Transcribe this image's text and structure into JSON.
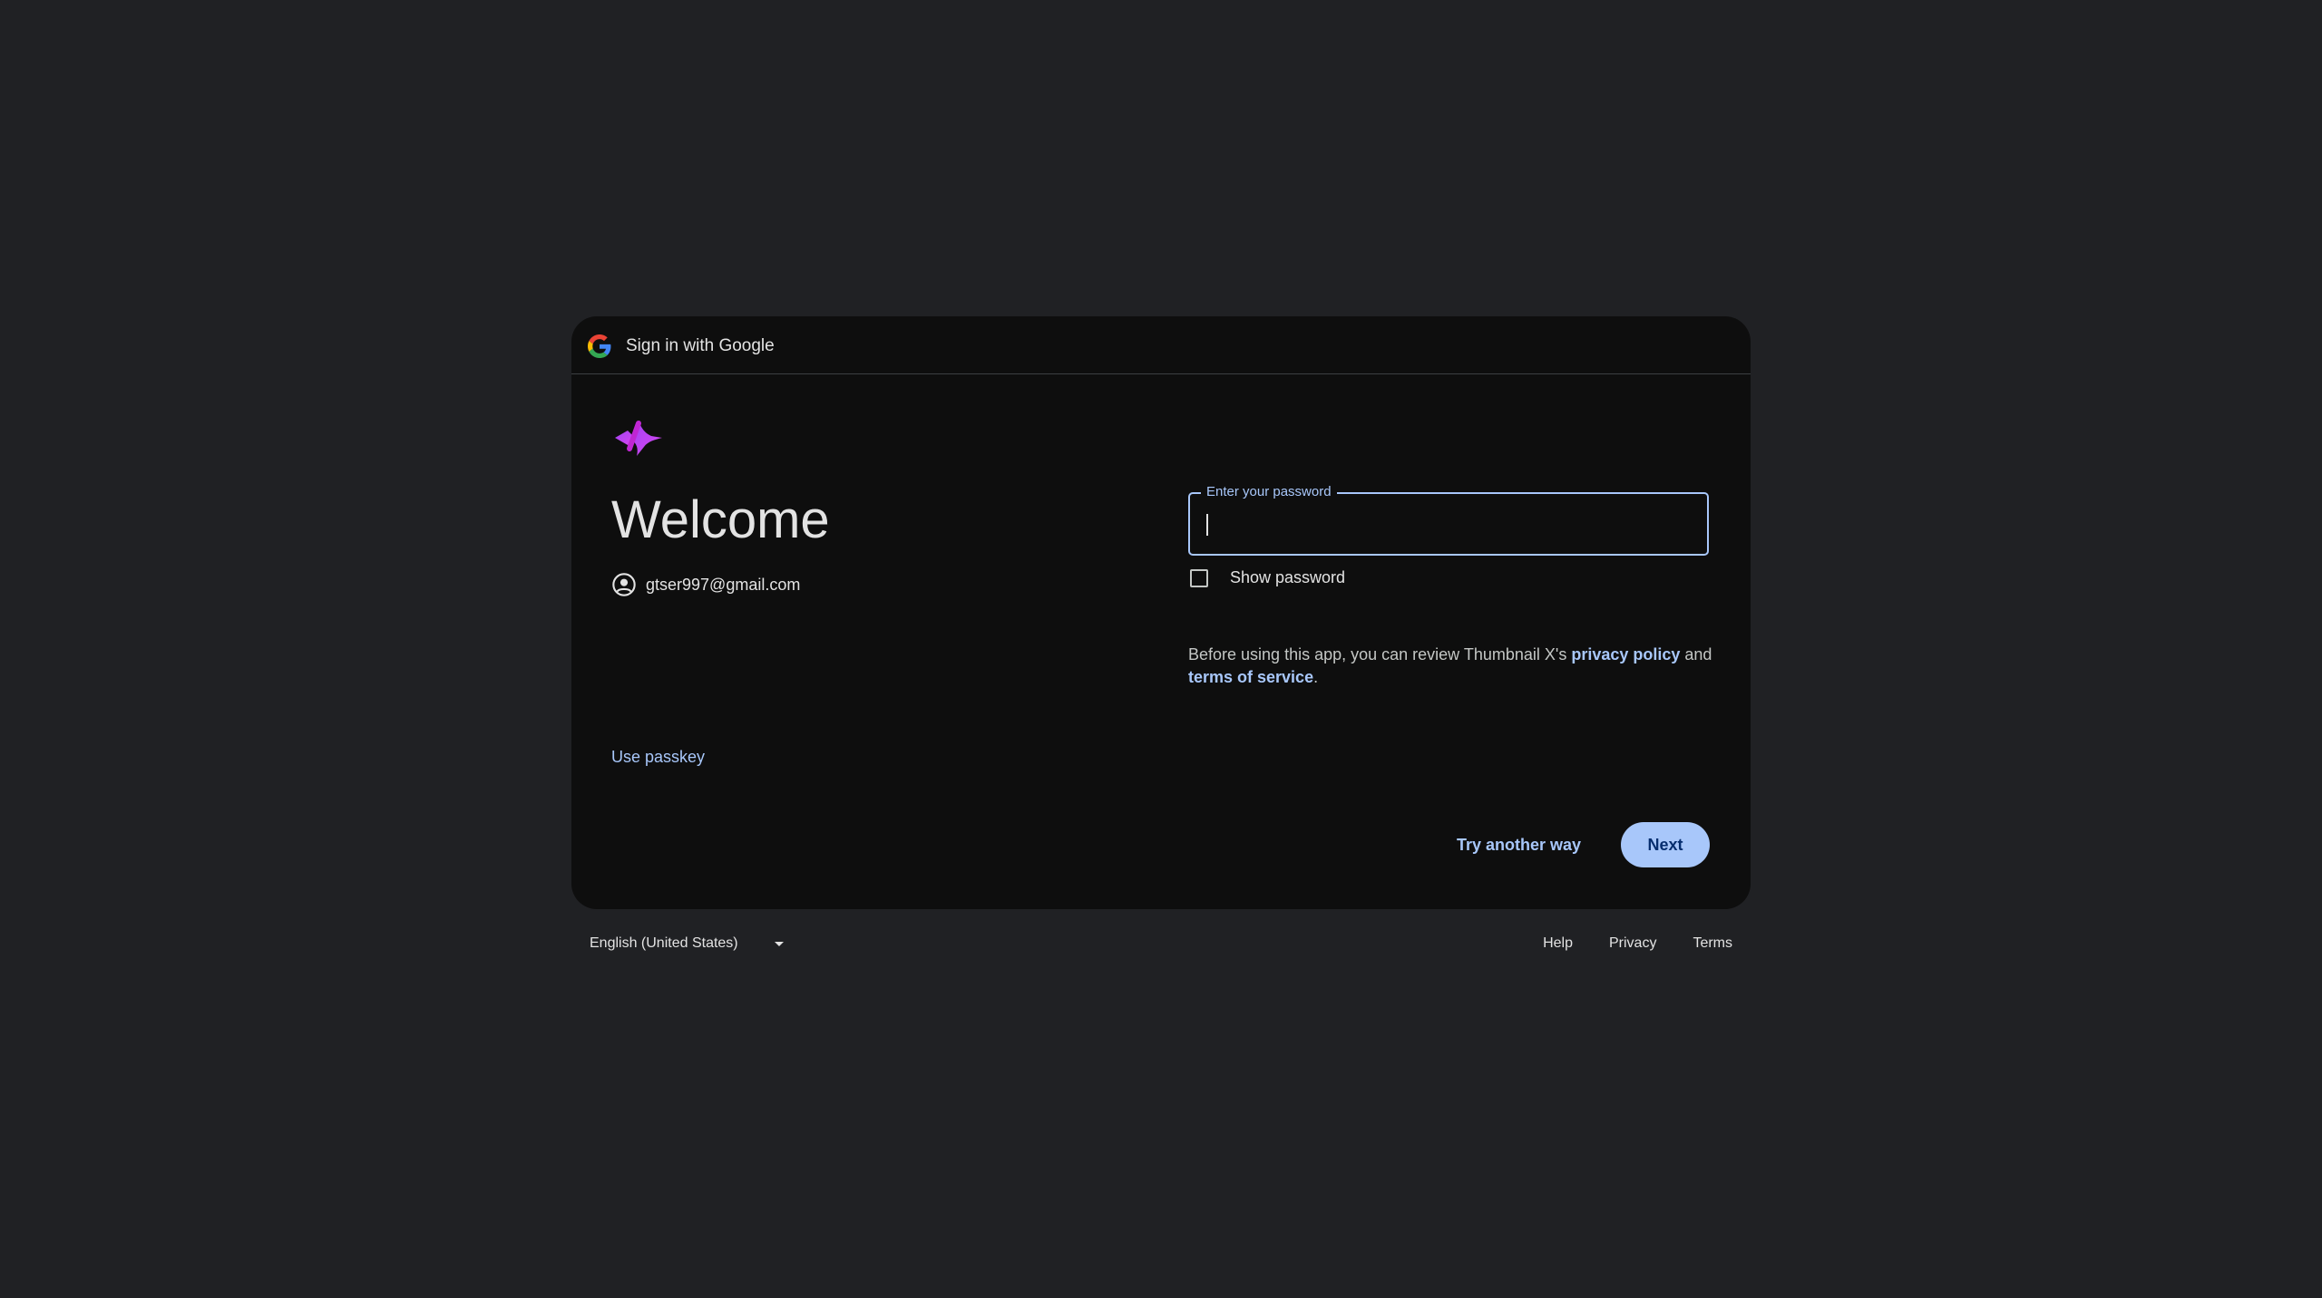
{
  "header": {
    "title": "Sign in with Google",
    "logo_icon": "google-g-icon"
  },
  "app": {
    "logo_icon": "thumbnail-x-logo",
    "accent_colors": [
      "#a142f4",
      "#d946ef"
    ]
  },
  "welcome": {
    "heading": "Welcome",
    "email": "gtser997@gmail.com",
    "account_icon": "account-circle-icon"
  },
  "password": {
    "label": "Enter your password",
    "value": "",
    "show_password_label": "Show password",
    "show_password_checked": false
  },
  "notice": {
    "prefix": "Before using this app, you can review Thumbnail X's ",
    "privacy_link": "privacy policy",
    "middle": " and",
    "terms_link": "terms of service",
    "suffix": "."
  },
  "actions": {
    "use_passkey": "Use passkey",
    "try_another_way": "Try another way",
    "next": "Next"
  },
  "footer": {
    "language": "English (United States)",
    "help": "Help",
    "privacy": "Privacy",
    "terms": "Terms"
  },
  "colors": {
    "background": "#202124",
    "card": "#0e0e0e",
    "accent": "#a8c7fa",
    "button_text": "#062e6f"
  }
}
